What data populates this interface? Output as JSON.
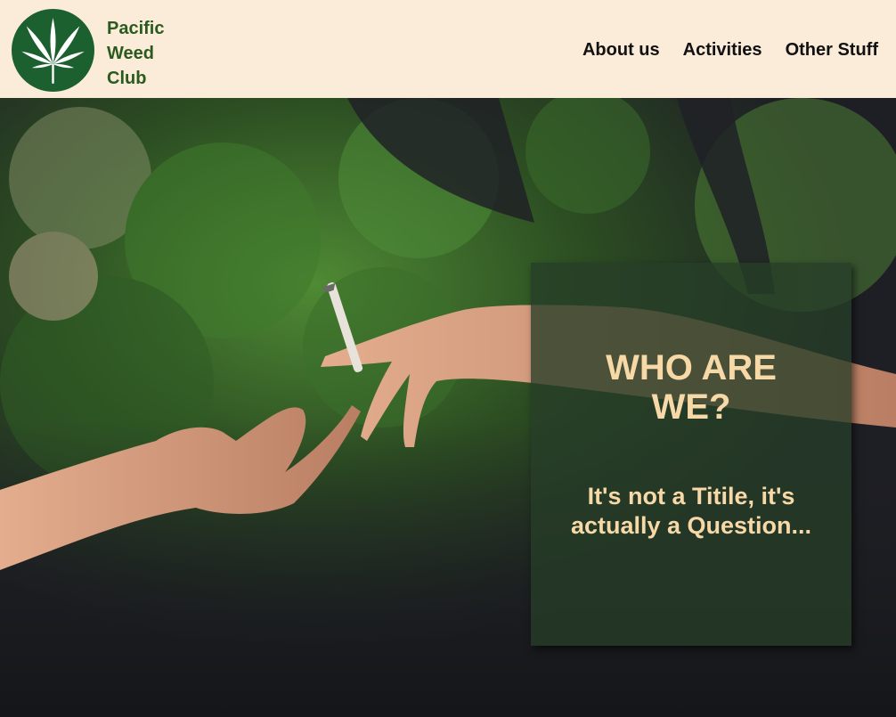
{
  "header": {
    "brand_lines": [
      "Pacific",
      "Weed",
      "Club"
    ],
    "logo_icon": "cannabis-leaf-icon",
    "nav": [
      {
        "label": "About us"
      },
      {
        "label": "Activities"
      },
      {
        "label": "Other Stuff"
      }
    ]
  },
  "hero": {
    "background_image": "hands-passing-joint-forest-photo",
    "title": "WHO ARE WE?",
    "subtitle": "It's not a Titile, it's actually a Question..."
  },
  "colors": {
    "header_bg": "#fbecd9",
    "brand_green": "#2a5a1e",
    "logo_green": "#1c6030",
    "panel_bg": "#263e28",
    "panel_text": "#f7d9a8"
  }
}
